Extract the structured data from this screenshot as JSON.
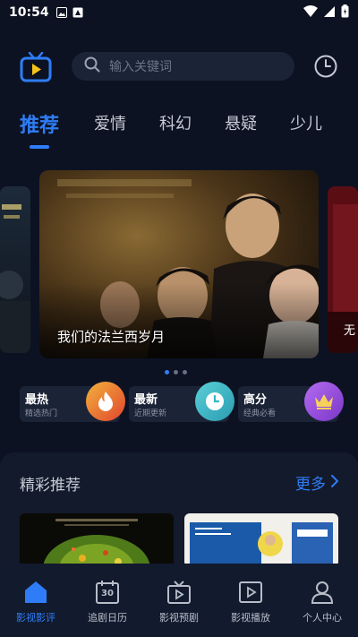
{
  "status_bar": {
    "time": "10:54"
  },
  "search": {
    "placeholder": "输入关键词"
  },
  "tabs": [
    {
      "label": "推荐",
      "active": true
    },
    {
      "label": "爱情"
    },
    {
      "label": "科幻"
    },
    {
      "label": "悬疑"
    },
    {
      "label": "少儿"
    }
  ],
  "banner": {
    "main_title": "我们的法兰西岁月",
    "right_peek_text": "无",
    "slides": 3,
    "active_slide": 1
  },
  "categories": [
    {
      "title": "最热",
      "subtitle": "精选热门",
      "icon": "flame-icon"
    },
    {
      "title": "最新",
      "subtitle": "近期更新",
      "icon": "clock-icon"
    },
    {
      "title": "高分",
      "subtitle": "经典必看",
      "icon": "crown-icon"
    }
  ],
  "recommended": {
    "title": "精彩推荐",
    "more_label": "更多"
  },
  "bottom_nav": [
    {
      "label": "影视影评",
      "icon": "home-icon",
      "active": true
    },
    {
      "label": "追剧日历",
      "icon": "calendar-icon",
      "day": "30"
    },
    {
      "label": "影视预剧",
      "icon": "tv-icon"
    },
    {
      "label": "影视播放",
      "icon": "play-icon"
    },
    {
      "label": "个人中心",
      "icon": "person-icon"
    }
  ],
  "colors": {
    "accent": "#2f7df6",
    "background": "#0c1222",
    "card": "#1b2336",
    "hot": "#f05a3c",
    "new": "#32b8c6",
    "top": "#9a4ee0"
  }
}
